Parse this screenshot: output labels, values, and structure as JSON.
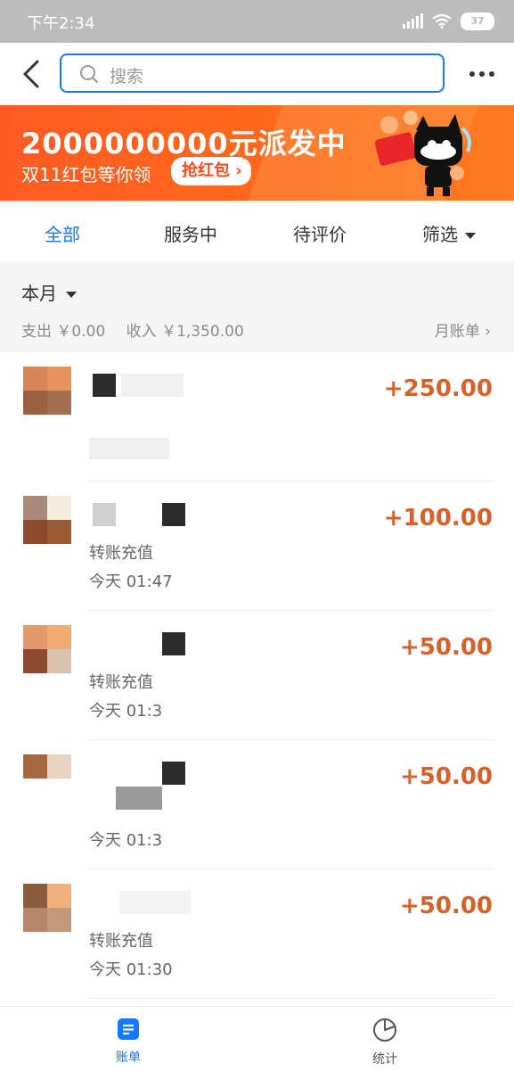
{
  "status_bar": {
    "time": "下午2:34",
    "battery": "37"
  },
  "header": {
    "search_placeholder": "搜索"
  },
  "banner": {
    "headline": "2000000000元派发中",
    "subline": "双11红包等你领",
    "button": "抢红包"
  },
  "tabs": [
    {
      "label": "全部",
      "active": true
    },
    {
      "label": "服务中",
      "active": false
    },
    {
      "label": "待评价",
      "active": false
    },
    {
      "label": "筛选",
      "active": false
    }
  ],
  "month": {
    "title": "本月",
    "expense": "支出 ￥0.00",
    "income": "收入 ￥1,350.00",
    "bill_link": "月账单"
  },
  "transactions": [
    {
      "amount": "+250.00",
      "desc": "",
      "time": ""
    },
    {
      "amount": "+100.00",
      "desc": "转账充值",
      "time": "今天  01:47"
    },
    {
      "amount": "+50.00",
      "desc": "转账充值",
      "time": "今天  01:3"
    },
    {
      "amount": "+50.00",
      "desc": "",
      "time": "今天  01:3"
    },
    {
      "amount": "+50.00",
      "desc": "转账充值",
      "time": "今天  01:30"
    }
  ],
  "bottom_nav": {
    "bill_label": "账单",
    "stats_label": "统计"
  },
  "colors": {
    "accent": "#1677ff",
    "amount": "#d4622a",
    "banner": "#ff5a22"
  },
  "icons": [
    "back-icon",
    "search-icon",
    "more-icon",
    "dropdown-caret-icon",
    "chevron-right-icon",
    "bill-icon",
    "pie-chart-icon"
  ]
}
